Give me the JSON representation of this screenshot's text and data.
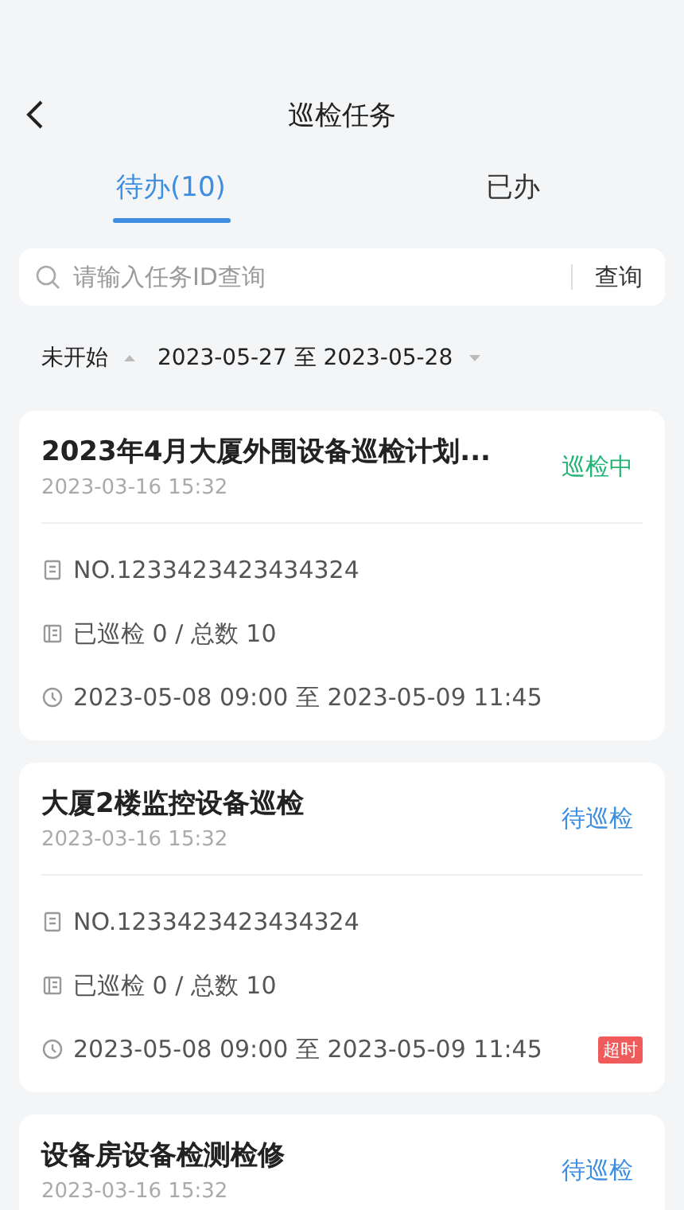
{
  "header": {
    "title": "巡检任务"
  },
  "tabs": [
    {
      "label": "待办(10)",
      "selected": true
    },
    {
      "label": "已办",
      "selected": false
    }
  ],
  "search": {
    "placeholder": "请输入任务ID查询",
    "button": "查询"
  },
  "filters": {
    "status": "未开始",
    "date_range": "2023-05-27 至 2023-05-28"
  },
  "tasks": [
    {
      "title": "2023年4月大厦外围设备巡检计划...",
      "created": "2023-03-16 15:32",
      "status": "巡检中",
      "kind": "in_progress",
      "number": "NO.1233423423434324",
      "progress": "已巡检 0 / 总数 10",
      "period": "2023-05-08 09:00 至 2023-05-09 11:45"
    },
    {
      "title": "大厦2楼监控设备巡检",
      "created": "2023-03-16 15:32",
      "status": "待巡检",
      "kind": "pending",
      "number": "NO.1233423423434324",
      "progress": "已巡检 0 / 总数 10",
      "period": "2023-05-08 09:00 至 2023-05-09 11:45",
      "badge": "超时"
    },
    {
      "title": "设备房设备检测检修",
      "created": "2023-03-16 15:32",
      "status": "待巡检",
      "kind": "pending"
    }
  ]
}
